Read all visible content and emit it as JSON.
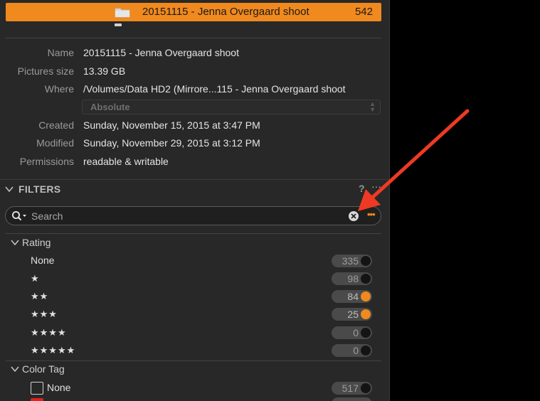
{
  "folder": {
    "name": "20151115 - Jenna Overgaard shoot",
    "count": "542"
  },
  "info": {
    "name_label": "Name",
    "name_value": "20151115 - Jenna Overgaard shoot",
    "size_label": "Pictures size",
    "size_value": "13.39 GB",
    "where_label": "Where",
    "where_value": "/Volumes/Data HD2 (Mirrore...115 - Jenna Overgaard shoot",
    "path_mode": "Absolute",
    "created_label": "Created",
    "created_value": "Sunday, November 15, 2015 at 3:47 PM",
    "modified_label": "Modified",
    "modified_value": "Sunday, November 29, 2015 at 3:12 PM",
    "permissions_label": "Permissions",
    "permissions_value": "readable & writable"
  },
  "filters": {
    "title": "FILTERS",
    "help": "?",
    "more": "···",
    "search_placeholder": "Search",
    "search_options": "•••",
    "rating": {
      "label": "Rating",
      "items": [
        {
          "label": "None",
          "count": "335",
          "enabled": false
        },
        {
          "label": "★",
          "count": "98",
          "enabled": false
        },
        {
          "label": "★★",
          "count": "84",
          "enabled": true
        },
        {
          "label": "★★★",
          "count": "25",
          "enabled": true
        },
        {
          "label": "★★★★",
          "count": "0",
          "enabled": false
        },
        {
          "label": "★★★★★",
          "count": "0",
          "enabled": false
        }
      ]
    },
    "color_tag": {
      "label": "Color Tag",
      "items": [
        {
          "label": "None",
          "count": "517",
          "enabled": false
        },
        {
          "label": "",
          "color": "#e0231b"
        }
      ]
    }
  },
  "colors": {
    "accent": "#f0891e",
    "annotation_arrow": "#ee3a24",
    "panel_bg": "#282828"
  }
}
